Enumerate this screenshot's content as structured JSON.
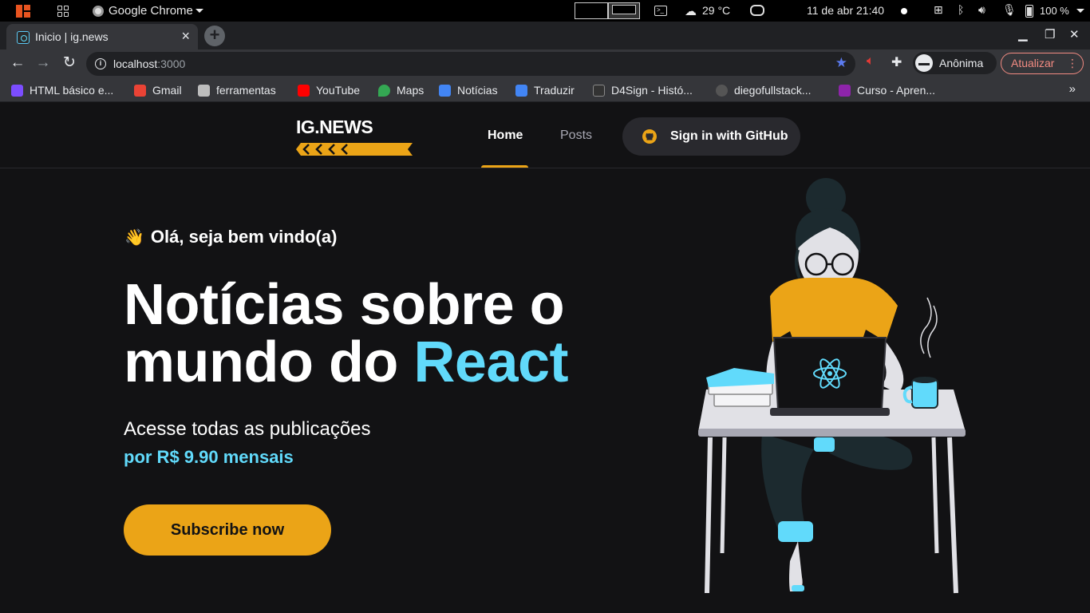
{
  "os": {
    "app_name": "Google Chrome",
    "temperature": "29 °C",
    "datetime": "11 de abr  21:40",
    "battery": "100 %"
  },
  "browser": {
    "tab_title": "Inicio | ig.news",
    "tab_close": "×",
    "new_tab": "+",
    "url_host": "localhost",
    "url_port": ":3000",
    "profile_label": "Anônima",
    "update_label": "Atualizar"
  },
  "bookmarks": [
    {
      "label": "HTML básico e...",
      "color": "#7c4dff"
    },
    {
      "label": "Gmail",
      "color": "#ea4335"
    },
    {
      "label": "ferramentas",
      "color": "#bdbdbd"
    },
    {
      "label": "YouTube",
      "color": "#ff0000"
    },
    {
      "label": "Maps",
      "color": "#34a853"
    },
    {
      "label": "Notícias",
      "color": "#4285f4"
    },
    {
      "label": "Traduzir",
      "color": "#4285f4"
    },
    {
      "label": "D4Sign - Histó...",
      "color": "#333333"
    },
    {
      "label": "diegofullstack...",
      "color": "#555555"
    },
    {
      "label": "Curso - Apren...",
      "color": "#8e24aa"
    }
  ],
  "site": {
    "logo": "IG.NEWS",
    "nav": {
      "home": "Home",
      "posts": "Posts"
    },
    "signin_label": "Sign in with GitHub",
    "welcome": "Olá, seja bem vindo(a)",
    "title_line1": "Notícias sobre o",
    "title_line2_plain": "mundo do ",
    "title_accent": "React",
    "subtitle": "Acesse todas as publicações",
    "price": "por R$ 9.90 mensais",
    "subscribe_label": "Subscribe now"
  },
  "colors": {
    "background": "#121214",
    "accent_yellow": "#eba417",
    "accent_cyan": "#61dafb",
    "surface": "#29292e"
  }
}
